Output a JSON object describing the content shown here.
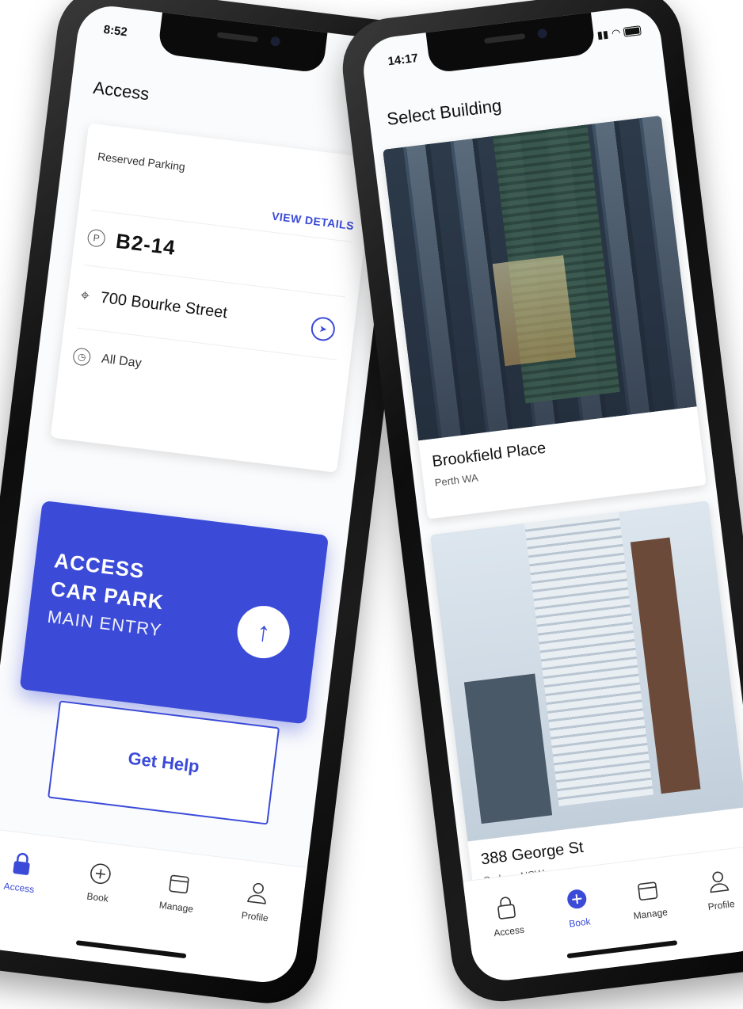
{
  "left_phone": {
    "status": {
      "time": "8:52"
    },
    "title": "Access",
    "reservation": {
      "label": "Reserved Parking",
      "view_details": "VIEW DETAILS",
      "bay": "B2-14",
      "bay_icon": "parking-icon",
      "address": "700 Bourke Street",
      "address_icon": "location-pin-icon",
      "hours": "All Day",
      "hours_icon": "clock-icon"
    },
    "access_panel": {
      "line1": "ACCESS",
      "line2": "CAR PARK",
      "line3": "MAIN ENTRY",
      "arrow_icon": "arrow-up-icon"
    },
    "help_button": "Get Help",
    "tabs": [
      {
        "label": "Access",
        "icon": "lock-icon",
        "active": true
      },
      {
        "label": "Book",
        "icon": "plus-circle-icon",
        "active": false
      },
      {
        "label": "Manage",
        "icon": "calendar-icon",
        "active": false
      },
      {
        "label": "Profile",
        "icon": "person-icon",
        "active": false
      }
    ]
  },
  "right_phone": {
    "status": {
      "time": "14:17"
    },
    "title": "Select Building",
    "buildings": [
      {
        "name": "Brookfield Place",
        "city": "Perth WA"
      },
      {
        "name": "388 George St",
        "city": "Sydney NSW"
      }
    ],
    "tabs": [
      {
        "label": "Access",
        "icon": "lock-icon",
        "active": false
      },
      {
        "label": "Book",
        "icon": "plus-circle-icon",
        "active": true
      },
      {
        "label": "Manage",
        "icon": "calendar-icon",
        "active": false
      },
      {
        "label": "Profile",
        "icon": "person-icon",
        "active": false
      }
    ]
  },
  "colors": {
    "accent": "#3b4bd8",
    "background": "#fafbfc"
  }
}
